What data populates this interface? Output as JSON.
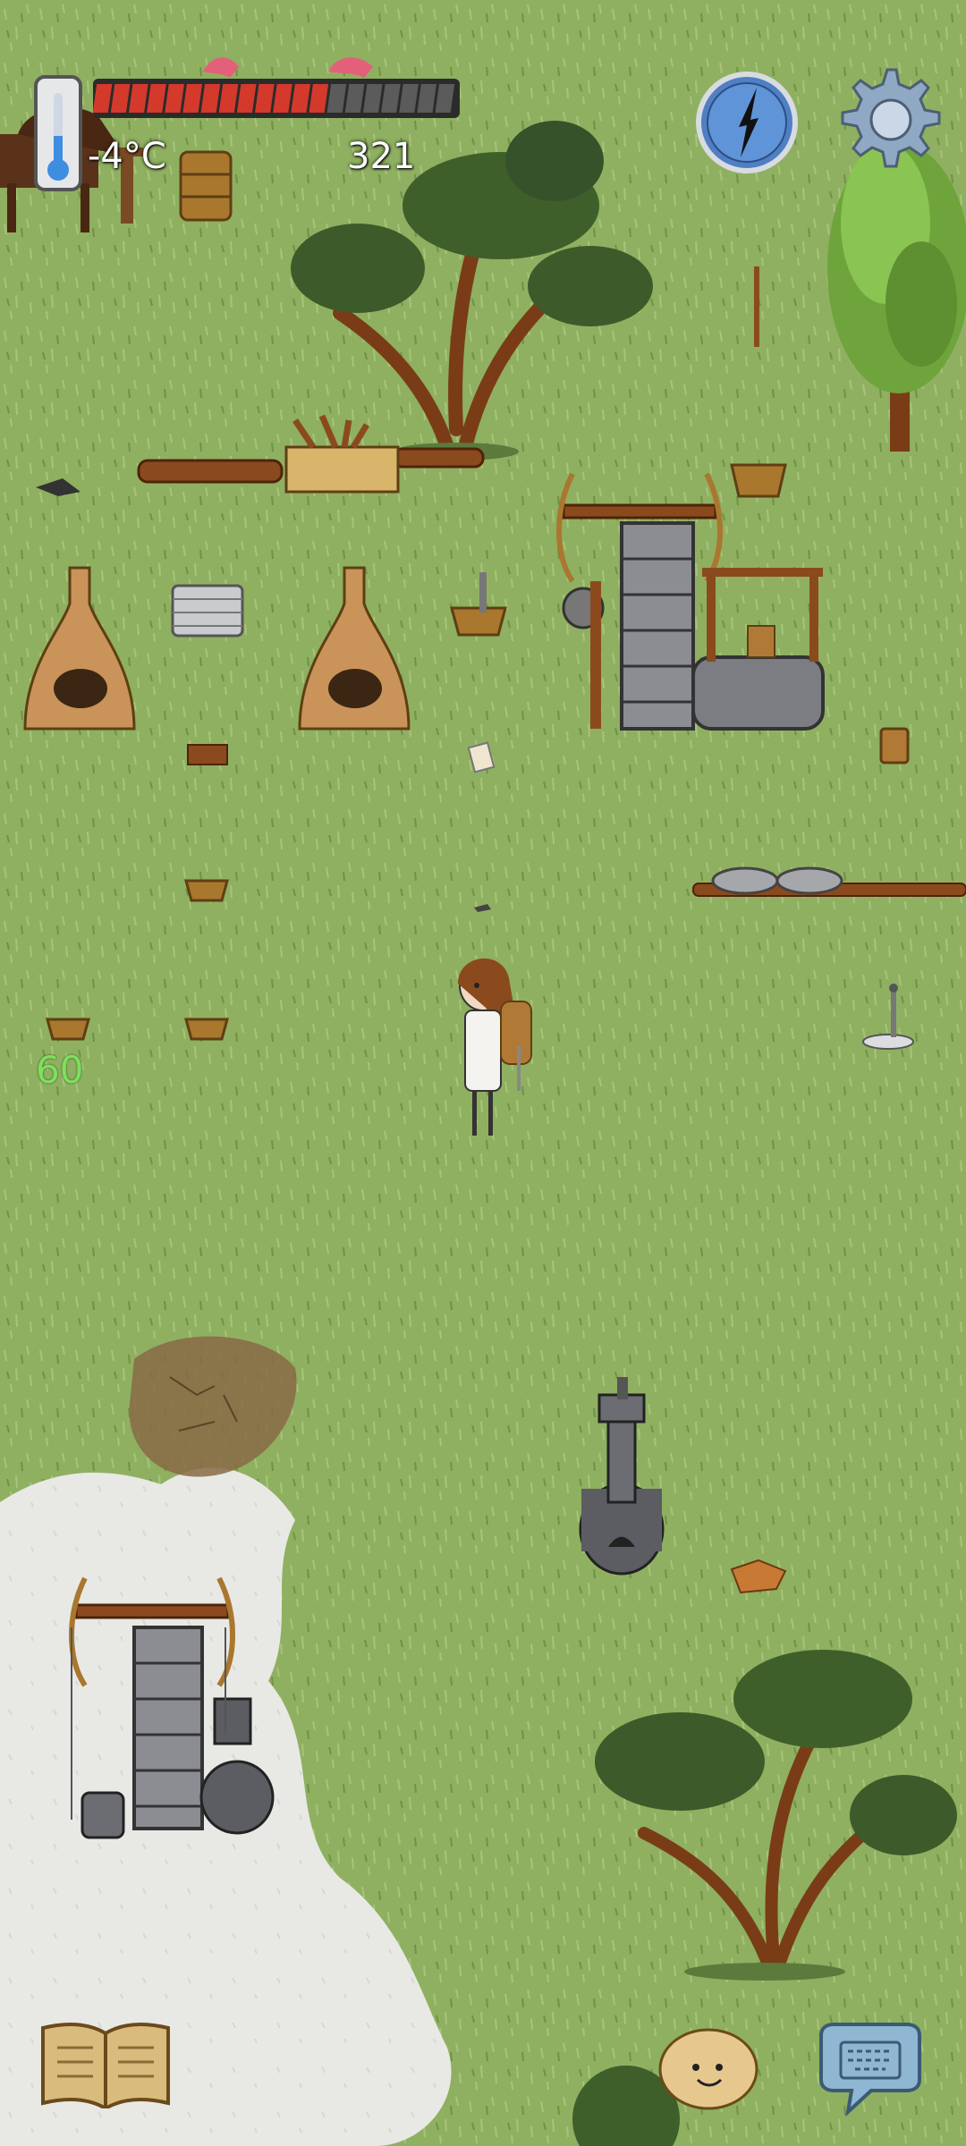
{
  "hud": {
    "temperature": "-4°C",
    "age_counter": "321",
    "food_bar": {
      "filled": 13,
      "total": 20,
      "fill_color": "#d33a2c",
      "empty_color": "#5b5b5b"
    },
    "floating_value": "60",
    "icons": {
      "thermometer": "thermometer-icon",
      "compass": "compass-icon",
      "settings": "gear-icon",
      "tech_book": "open-book-icon",
      "emote": "smiley-face-icon",
      "keyboard": "keyboard-chat-icon"
    }
  },
  "colors": {
    "grass": "#8fb061",
    "snow": "#e9eae6",
    "dirt": "#8a6a45",
    "stone": "#8b8d93",
    "wood": "#8b4a1e",
    "basket": "#a9772e"
  }
}
